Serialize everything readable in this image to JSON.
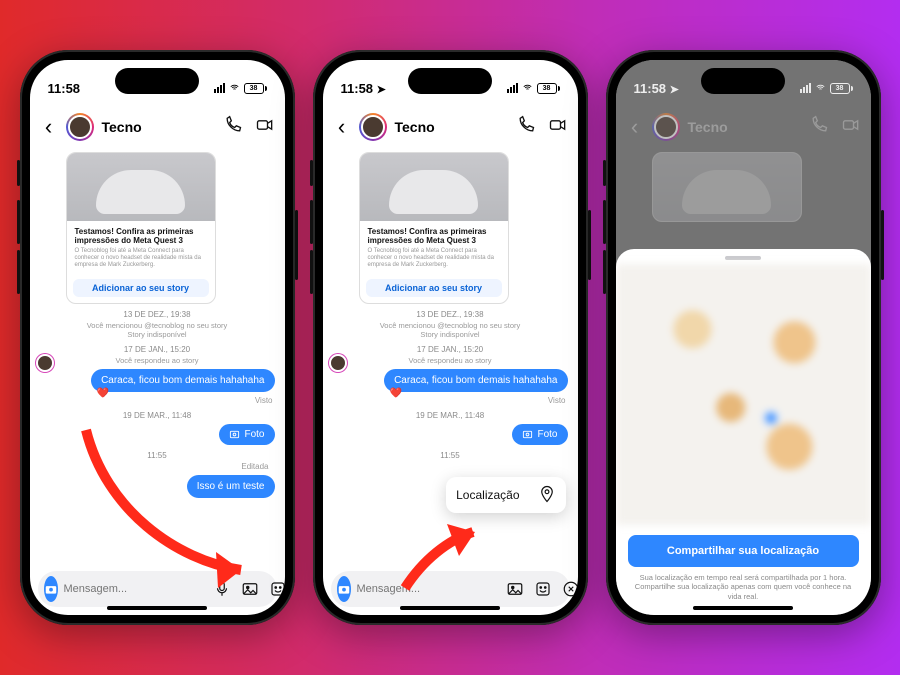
{
  "status": {
    "time": "11:58",
    "battery_pct": "38"
  },
  "header": {
    "contact_name": "Tecno",
    "call_icon": "phone-icon",
    "video_icon": "video-icon",
    "back_icon": "chevron-left-icon"
  },
  "story_card": {
    "headline": "Testamos! Confira as primeiras impressões do Meta Quest 3",
    "subtext": "O Tecnoblog foi até a Meta Connect para conhecer o novo headset de realidade mista da empresa de Mark Zuckerberg.",
    "cta": "Adicionar ao seu story"
  },
  "timeline": {
    "ts1": "13 DE DEZ., 19:38",
    "sys1": "Você mencionou @tecnoblog no seu story",
    "sys2": "Story indisponível",
    "ts2": "17 DE JAN., 15:20",
    "sys3": "Você respondeu ao story",
    "msg1": "Caraca, ficou bom demais hahahaha",
    "seen": "Visto",
    "ts3": "19 DE MAR., 11:48",
    "photo_label": "Foto",
    "ts4": "11:55",
    "edited": "Editada",
    "msg2": "Isso é um teste"
  },
  "composer": {
    "placeholder": "Mensagem...",
    "mic_icon": "mic-icon",
    "gallery_icon": "image-icon",
    "sticker_icon": "sticker-icon",
    "plus_icon": "plus-circle-icon",
    "close_icon": "close-circle-icon"
  },
  "location_popup": {
    "label": "Localização"
  },
  "share_sheet": {
    "button": "Compartilhar sua localização",
    "disclaimer": "Sua localização em tempo real será compartilhada por 1 hora. Compartilhe sua localização apenas com quem você conhece na vida real."
  }
}
